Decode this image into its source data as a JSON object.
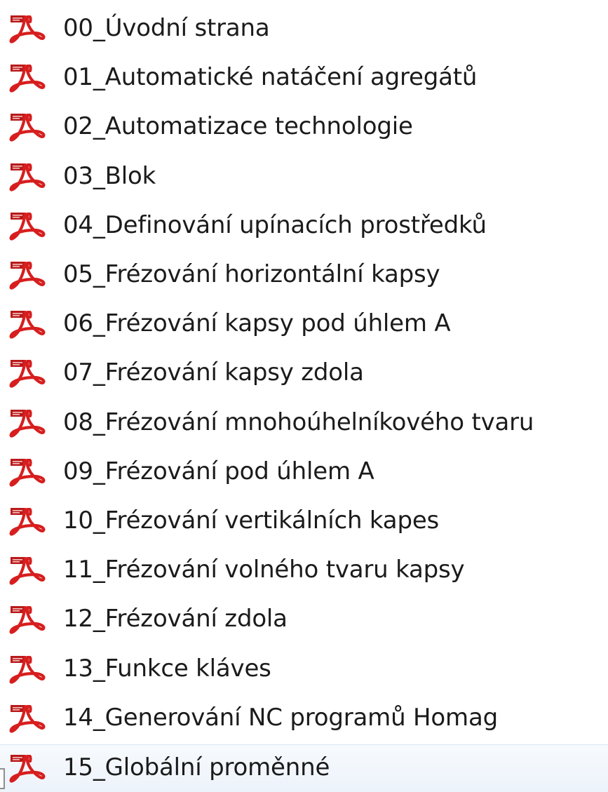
{
  "file_list": {
    "icon": "pdf-file-icon",
    "colors": {
      "pdf_red": "#d71e1e",
      "pdf_tab": "#b91a1a",
      "text": "#1b1b1b",
      "hover_bg": "#edf3fb"
    },
    "items": [
      {
        "name": "00_Úvodní strana"
      },
      {
        "name": "01_Automatické natáčení agregátů"
      },
      {
        "name": "02_Automatizace technologie"
      },
      {
        "name": "03_Blok"
      },
      {
        "name": "04_Definování upínacích prostředků"
      },
      {
        "name": "05_Frézování horizontální kapsy"
      },
      {
        "name": "06_Frézování kapsy pod úhlem A"
      },
      {
        "name": "07_Frézování kapsy zdola"
      },
      {
        "name": "08_Frézování mnohoúhelníkového tvaru"
      },
      {
        "name": "09_Frézování pod úhlem A"
      },
      {
        "name": "10_Frézování vertikálních kapes"
      },
      {
        "name": "11_Frézování volného tvaru kapsy"
      },
      {
        "name": "12_Frézování zdola"
      },
      {
        "name": "13_Funkce kláves"
      },
      {
        "name": "14_Generování NC programů Homag"
      },
      {
        "name": "15_Globální proměnné",
        "hovered": true
      }
    ]
  }
}
